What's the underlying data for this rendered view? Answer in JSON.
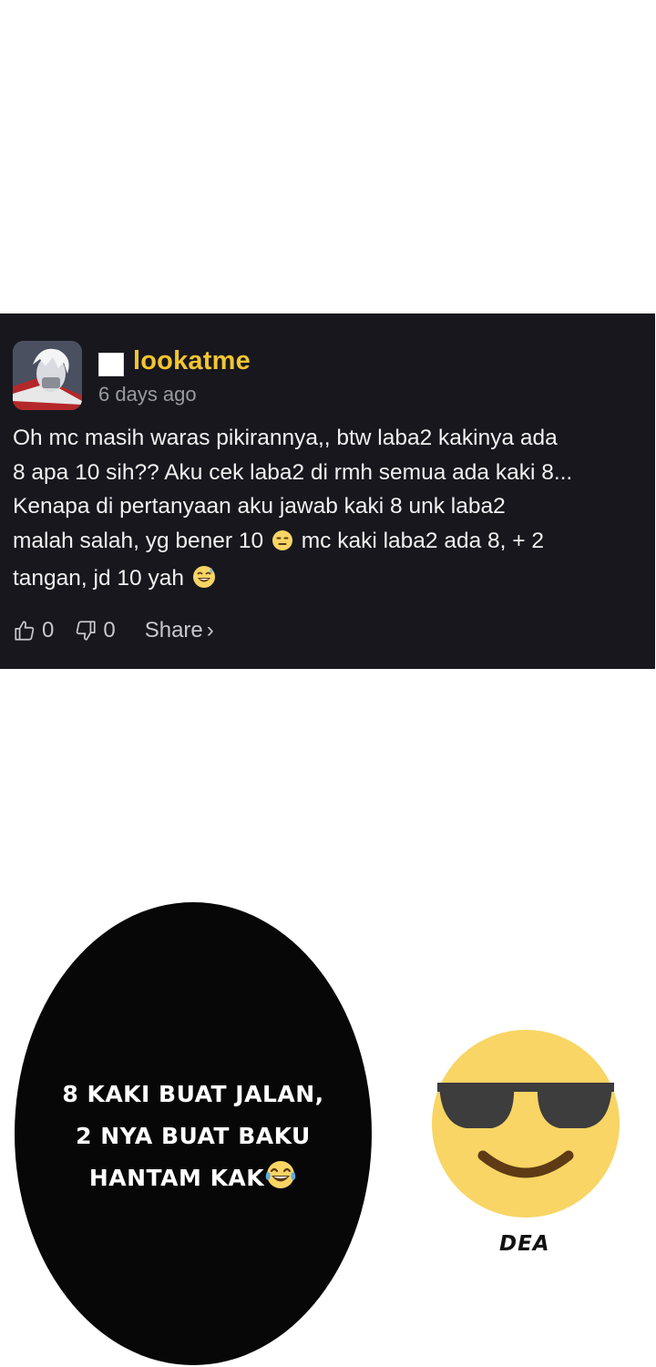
{
  "comment": {
    "username": "lookatme",
    "timestamp": "6 days ago",
    "body_line1": "Oh mc masih waras pikirannya,, btw laba2 kakinya ada",
    "body_line2": "8 apa 10 sih?? Aku cek laba2 di rmh semua ada kaki 8...",
    "body_line3": "Kenapa di pertanyaan aku jawab kaki 8 unk laba2",
    "body_line4a": "malah salah, yg bener 10",
    "body_line4b": "mc kaki laba2 ada 8, + 2",
    "body_line5": "tangan, jd 10 yah",
    "likes": "0",
    "dislikes": "0",
    "share_label": "Share",
    "share_chevron": "›"
  },
  "icons": {
    "expressionless": "expressionless-face-icon",
    "sweat_smile": "sweat-smile-face-icon",
    "thumbs_up": "thumbs-up-icon",
    "thumbs_down": "thumbs-down-icon",
    "laughing_tears": "tears-of-joy-icon",
    "sunglasses": "sunglasses-face-icon"
  },
  "panel": {
    "bubble_line1": "8 KAKI BUAT JALAN,",
    "bubble_line2": "2 NYA BUAT BAKU",
    "bubble_line3": "HANTAM KAK",
    "speaker_label": "DEA"
  },
  "colors": {
    "card_bg": "#17171d",
    "username": "#f2c530",
    "emoji_yellow": "#f8d564"
  }
}
